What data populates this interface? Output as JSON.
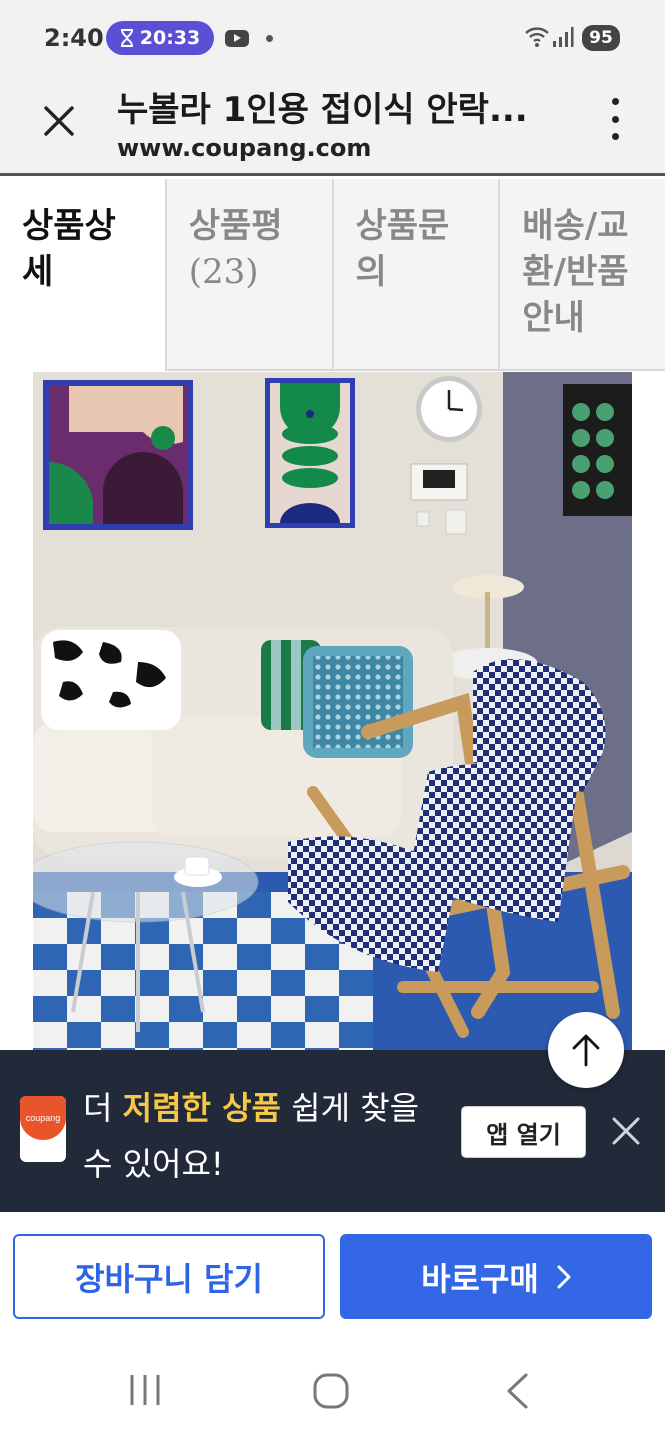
{
  "status_bar": {
    "time": "2:40",
    "timer_pill": "20:33",
    "battery": "95"
  },
  "header": {
    "title": "누볼라 1인용 접이식 안락...",
    "url": "www.coupang.com"
  },
  "tabs": [
    {
      "label": "상품상세",
      "count": ""
    },
    {
      "label": "상품평",
      "count": "(23)"
    },
    {
      "label": "상품문의",
      "count": ""
    },
    {
      "label": "배송/교환/반품안내",
      "count": ""
    }
  ],
  "app_banner": {
    "text_before": "더 ",
    "text_highlight": "저렴한 상품",
    "text_after": " 쉽게 찾을 수 있어요!",
    "open_app_label": "앱 열기",
    "logo_text": "coupang"
  },
  "actions": {
    "cart_label": "장바구니 담기",
    "buy_label": "바로구매"
  },
  "colors": {
    "accent": "#3467e6",
    "banner_bg": "#222a3a",
    "banner_highlight": "#f7c847",
    "pill": "#5b4fd6"
  },
  "icons": {
    "close": "close-icon",
    "more": "more-vertical-icon",
    "scroll_top": "arrow-up-icon",
    "buy_chevron": "chevron-right-icon",
    "nav_recents": "recents-icon",
    "nav_home": "home-icon",
    "nav_back": "back-icon"
  }
}
